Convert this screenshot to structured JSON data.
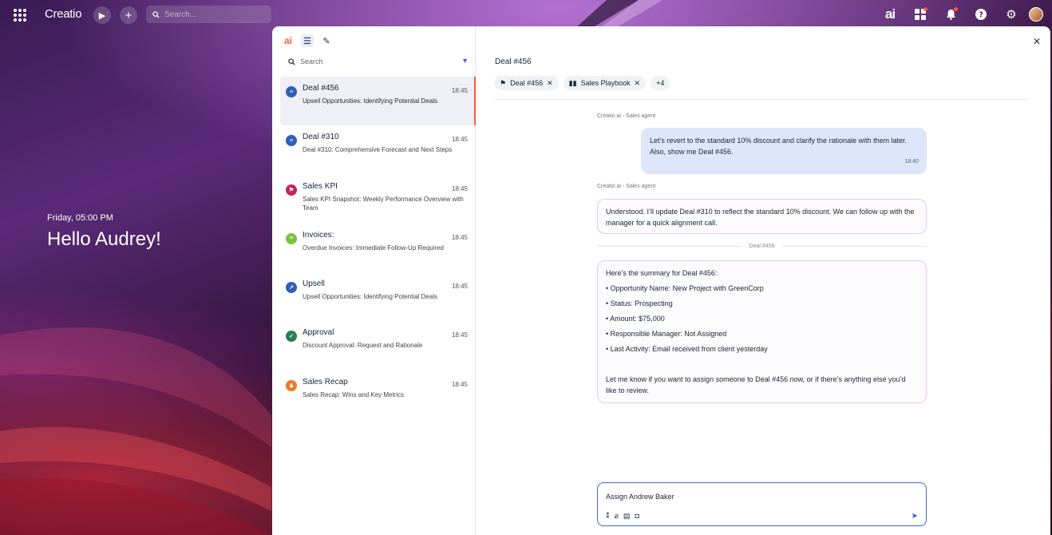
{
  "topbar": {
    "logo": "Creatio",
    "search_placeholder": "Search...",
    "ai_label": "ai"
  },
  "greeting": {
    "date": "Friday, 05:00 PM",
    "hello": "Hello Audrey!"
  },
  "sidebar": {
    "ai_tool": "ai",
    "search_placeholder": "Search",
    "items": [
      {
        "title": "Deal #456",
        "time": "18:45",
        "subtitle": "Upsell Opportunities: Identifying Potential Deals",
        "icon": "deal-icon",
        "color": "#2f5fb8"
      },
      {
        "title": "Deal #310",
        "time": "18:45",
        "subtitle": "Deal #310: Comprehensive Forecast and Next Steps",
        "icon": "deal-icon",
        "color": "#2f5fb8"
      },
      {
        "title": "Sales KPI",
        "time": "18:45",
        "subtitle": "Sales KPI Snapshot: Weekly Performance Overview with Team",
        "icon": "flag-icon",
        "color": "#c8245a"
      },
      {
        "title": "Invoices:",
        "time": "18:45",
        "subtitle": "Overdue Invoices: Immediate Follow-Up Required",
        "icon": "invoice-icon",
        "color": "#7cc243"
      },
      {
        "title": "Upsell",
        "time": "18:45",
        "subtitle": "Upsell Opportunities: Identifying Potential Deals",
        "icon": "upsell-icon",
        "color": "#2f5fb8"
      },
      {
        "title": "Approval",
        "time": "18:45",
        "subtitle": "Discount Approval: Request and Rationale",
        "icon": "approval-icon",
        "color": "#2e7d4f"
      },
      {
        "title": "Sales Recap",
        "time": "18:45",
        "subtitle": "Sales Recap: Wins and Key Metrics",
        "icon": "recap-icon",
        "color": "#ef7a2f"
      }
    ]
  },
  "chat": {
    "title": "Deal #456",
    "chips": [
      {
        "label": "Deal #456",
        "icon": "flag-icon"
      },
      {
        "label": "Sales Playbook",
        "icon": "book-icon"
      }
    ],
    "chips_more": "+4",
    "sender_label": "Creatio.ai - Sales agent",
    "user_message": "Let’s revert to the standard 10% discount and clarify the rationale with them later. Also, show me Deal #456.",
    "user_time": "18:40",
    "agent_reply": "Understood. I’ll update Deal #310 to reflect the standard 10% discount. We can follow up with the manager for a quick alignment call.",
    "separator": "Deal #456",
    "summary_intro": "Here’s the summary for Deal #456:",
    "summary_lines": [
      "• Opportunity Name: New Project with GreenCorp",
      "• Status: Prospecting",
      "• Amount: $75,000",
      "• Responsible Manager: Not Assigned",
      "• Last Activity: Email received from client yesterday"
    ],
    "summary_outro": "Let me know if you want to assign someone to Deal #456 now, or if there’s anything else you’d like to review.",
    "composer_value": "Assign Andrew Baker"
  }
}
